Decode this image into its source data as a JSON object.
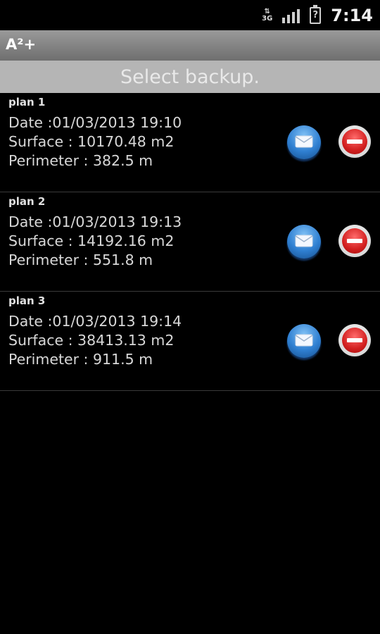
{
  "status_bar": {
    "network_type": "3G",
    "time": "7:14"
  },
  "app": {
    "title": "A²+"
  },
  "header": {
    "label": "Select backup."
  },
  "backups": [
    {
      "name": "plan 1",
      "date": "Date :01/03/2013 19:10",
      "surface": "Surface : 10170.48 m2",
      "perimeter": "Perimeter : 382.5 m"
    },
    {
      "name": "plan 2",
      "date": "Date :01/03/2013 19:13",
      "surface": "Surface : 14192.16 m2",
      "perimeter": "Perimeter : 551.8 m"
    },
    {
      "name": "plan 3",
      "date": "Date :01/03/2013 19:14",
      "surface": "Surface : 38413.13 m2",
      "perimeter": "Perimeter : 911.5 m"
    }
  ],
  "icons": {
    "send": "mail-icon",
    "delete": "delete-icon"
  },
  "colors": {
    "background": "#000000",
    "title_bar": "#8a8a8a",
    "section_header": "#b5b5b5",
    "mail_accent": "#2f7fd1",
    "delete_accent": "#d21f1f"
  }
}
